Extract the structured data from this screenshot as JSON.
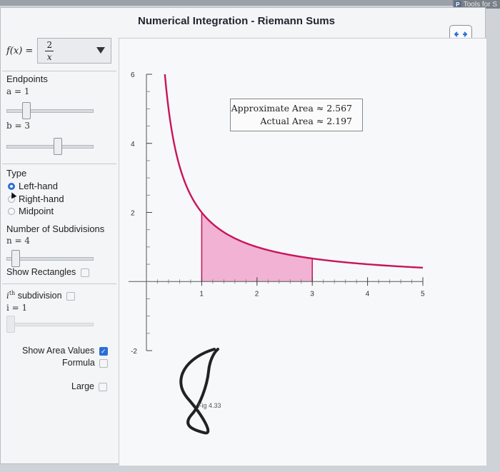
{
  "brand": {
    "badge": "P",
    "text": "Tools for S"
  },
  "title": "Numerical Integration - Riemann Sums",
  "function": {
    "label": "f(x) =",
    "numerator": "2",
    "denominator": "x"
  },
  "endpoints": {
    "heading": "Endpoints",
    "a_label": "a = 1",
    "a_value": 1,
    "a_range": [
      0,
      5
    ],
    "b_label": "b = 3",
    "b_value": 3,
    "b_range": [
      0,
      5
    ]
  },
  "type": {
    "heading": "Type",
    "options": [
      "Left-hand",
      "Right-hand",
      "Midpoint"
    ],
    "selected": "Left-hand"
  },
  "subdivisions": {
    "heading": "Number of Subdivisions",
    "n_label": "n = 4",
    "n_value": 4,
    "n_range": [
      1,
      50
    ]
  },
  "show_rectangles": {
    "label": "Show Rectangles",
    "checked": false
  },
  "ith": {
    "label": "subdivision",
    "sup": "th",
    "i_label": "i = 1",
    "checked": false
  },
  "show_area_values": {
    "label": "Show Area Values",
    "checked": true
  },
  "formula": {
    "label": "Formula",
    "checked": false
  },
  "large": {
    "label": "Large",
    "checked": false
  },
  "legend": {
    "approx": "Approximate Area ≈ 2.567",
    "actual": "Actual Area ≈ 2.197"
  },
  "figcap": "Fig 4.33",
  "colors": {
    "curve": "#c8145a",
    "fill": "#f0a6cc",
    "accent": "#2a6fd6"
  },
  "chart_data": {
    "type": "line",
    "function": "2/x",
    "xlim": [
      0,
      5
    ],
    "ylim": [
      -2,
      6
    ],
    "x_ticks": [
      1,
      2,
      3,
      4,
      5
    ],
    "y_ticks": [
      -2,
      2,
      4,
      6
    ],
    "shaded_interval": [
      1,
      3
    ],
    "approximate_area": 2.567,
    "actual_area": 2.197
  }
}
